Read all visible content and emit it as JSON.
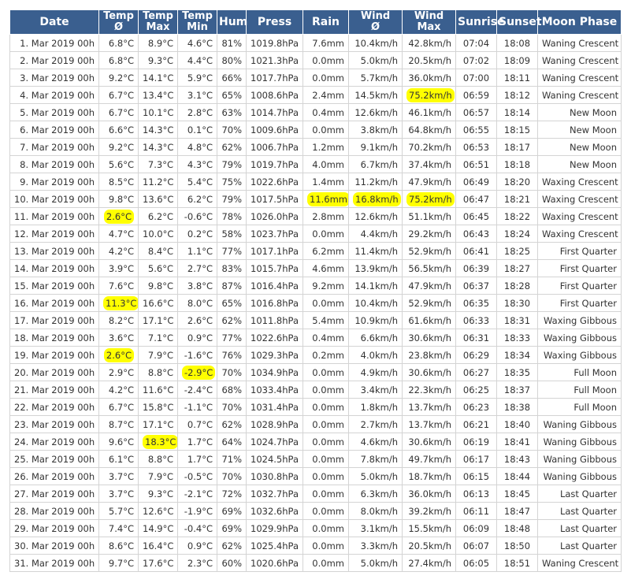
{
  "headers": [
    {
      "l1": "Date",
      "l2": ""
    },
    {
      "l1": "Temp",
      "l2": "Ø"
    },
    {
      "l1": "Temp",
      "l2": "Max"
    },
    {
      "l1": "Temp",
      "l2": "Min"
    },
    {
      "l1": "Hum",
      "l2": ""
    },
    {
      "l1": "Press",
      "l2": ""
    },
    {
      "l1": "Rain",
      "l2": ""
    },
    {
      "l1": "Wind",
      "l2": "Ø"
    },
    {
      "l1": "Wind",
      "l2": "Max"
    },
    {
      "l1": "Sunrise",
      "l2": ""
    },
    {
      "l1": "Sunset",
      "l2": ""
    },
    {
      "l1": "Moon Phase",
      "l2": ""
    }
  ],
  "highlight_color": "#ffff00",
  "header_color": "#3a5f8f",
  "rows": [
    [
      "1. Mar 2019 00h",
      "6.8°C",
      "8.9°C",
      "4.6°C",
      "81%",
      "1019.8hPa",
      "7.6mm",
      "10.4km/h",
      "42.8km/h",
      "07:04",
      "18:08",
      "Waning Crescent"
    ],
    [
      "2. Mar 2019 00h",
      "6.8°C",
      "9.3°C",
      "4.4°C",
      "80%",
      "1021.3hPa",
      "0.0mm",
      "5.0km/h",
      "20.5km/h",
      "07:02",
      "18:09",
      "Waning Crescent"
    ],
    [
      "3. Mar 2019 00h",
      "9.2°C",
      "14.1°C",
      "5.9°C",
      "66%",
      "1017.7hPa",
      "0.0mm",
      "5.7km/h",
      "36.0km/h",
      "07:00",
      "18:11",
      "Waning Crescent"
    ],
    [
      "4. Mar 2019 00h",
      "6.7°C",
      "13.4°C",
      "3.1°C",
      "65%",
      "1008.6hPa",
      "2.4mm",
      "14.5km/h",
      "75.2km/h",
      "06:59",
      "18:12",
      "Waning Crescent"
    ],
    [
      "5. Mar 2019 00h",
      "6.7°C",
      "10.1°C",
      "2.8°C",
      "63%",
      "1014.7hPa",
      "0.4mm",
      "12.6km/h",
      "46.1km/h",
      "06:57",
      "18:14",
      "New Moon"
    ],
    [
      "6. Mar 2019 00h",
      "6.6°C",
      "14.3°C",
      "0.1°C",
      "70%",
      "1009.6hPa",
      "0.0mm",
      "3.8km/h",
      "64.8km/h",
      "06:55",
      "18:15",
      "New Moon"
    ],
    [
      "7. Mar 2019 00h",
      "9.2°C",
      "14.3°C",
      "4.8°C",
      "62%",
      "1006.7hPa",
      "1.2mm",
      "9.1km/h",
      "70.2km/h",
      "06:53",
      "18:17",
      "New Moon"
    ],
    [
      "8. Mar 2019 00h",
      "5.6°C",
      "7.3°C",
      "4.3°C",
      "79%",
      "1019.7hPa",
      "4.0mm",
      "6.7km/h",
      "37.4km/h",
      "06:51",
      "18:18",
      "New Moon"
    ],
    [
      "9. Mar 2019 00h",
      "8.5°C",
      "11.2°C",
      "5.4°C",
      "75%",
      "1022.6hPa",
      "1.4mm",
      "11.2km/h",
      "47.9km/h",
      "06:49",
      "18:20",
      "Waxing Crescent"
    ],
    [
      "10. Mar 2019 00h",
      "9.8°C",
      "13.6°C",
      "6.2°C",
      "79%",
      "1017.5hPa",
      "11.6mm",
      "16.8km/h",
      "75.2km/h",
      "06:47",
      "18:21",
      "Waxing Crescent"
    ],
    [
      "11. Mar 2019 00h",
      "2.6°C",
      "6.2°C",
      "-0.6°C",
      "78%",
      "1026.0hPa",
      "2.8mm",
      "12.6km/h",
      "51.1km/h",
      "06:45",
      "18:22",
      "Waxing Crescent"
    ],
    [
      "12. Mar 2019 00h",
      "4.7°C",
      "10.0°C",
      "0.2°C",
      "58%",
      "1023.7hPa",
      "0.0mm",
      "4.4km/h",
      "29.2km/h",
      "06:43",
      "18:24",
      "Waxing Crescent"
    ],
    [
      "13. Mar 2019 00h",
      "4.2°C",
      "8.4°C",
      "1.1°C",
      "77%",
      "1017.1hPa",
      "6.2mm",
      "11.4km/h",
      "52.9km/h",
      "06:41",
      "18:25",
      "First Quarter"
    ],
    [
      "14. Mar 2019 00h",
      "3.9°C",
      "5.6°C",
      "2.7°C",
      "83%",
      "1015.7hPa",
      "4.6mm",
      "13.9km/h",
      "56.5km/h",
      "06:39",
      "18:27",
      "First Quarter"
    ],
    [
      "15. Mar 2019 00h",
      "7.6°C",
      "9.8°C",
      "3.8°C",
      "87%",
      "1016.4hPa",
      "9.2mm",
      "14.1km/h",
      "47.9km/h",
      "06:37",
      "18:28",
      "First Quarter"
    ],
    [
      "16. Mar 2019 00h",
      "11.3°C",
      "16.6°C",
      "8.0°C",
      "65%",
      "1016.8hPa",
      "0.0mm",
      "10.4km/h",
      "52.9km/h",
      "06:35",
      "18:30",
      "First Quarter"
    ],
    [
      "17. Mar 2019 00h",
      "8.2°C",
      "17.1°C",
      "2.6°C",
      "62%",
      "1011.8hPa",
      "5.4mm",
      "10.9km/h",
      "61.6km/h",
      "06:33",
      "18:31",
      "Waxing Gibbous"
    ],
    [
      "18. Mar 2019 00h",
      "3.6°C",
      "7.1°C",
      "0.9°C",
      "77%",
      "1022.6hPa",
      "0.4mm",
      "6.6km/h",
      "30.6km/h",
      "06:31",
      "18:33",
      "Waxing Gibbous"
    ],
    [
      "19. Mar 2019 00h",
      "2.6°C",
      "7.9°C",
      "-1.6°C",
      "76%",
      "1029.3hPa",
      "0.2mm",
      "4.0km/h",
      "23.8km/h",
      "06:29",
      "18:34",
      "Waxing Gibbous"
    ],
    [
      "20. Mar 2019 00h",
      "2.9°C",
      "8.8°C",
      "-2.9°C",
      "70%",
      "1034.9hPa",
      "0.0mm",
      "4.9km/h",
      "30.6km/h",
      "06:27",
      "18:35",
      "Full Moon"
    ],
    [
      "21. Mar 2019 00h",
      "4.2°C",
      "11.6°C",
      "-2.4°C",
      "68%",
      "1033.4hPa",
      "0.0mm",
      "3.4km/h",
      "22.3km/h",
      "06:25",
      "18:37",
      "Full Moon"
    ],
    [
      "22. Mar 2019 00h",
      "6.7°C",
      "15.8°C",
      "-1.1°C",
      "70%",
      "1031.4hPa",
      "0.0mm",
      "1.8km/h",
      "13.7km/h",
      "06:23",
      "18:38",
      "Full Moon"
    ],
    [
      "23. Mar 2019 00h",
      "8.7°C",
      "17.1°C",
      "0.7°C",
      "62%",
      "1028.9hPa",
      "0.0mm",
      "2.7km/h",
      "13.7km/h",
      "06:21",
      "18:40",
      "Waning Gibbous"
    ],
    [
      "24. Mar 2019 00h",
      "9.6°C",
      "18.3°C",
      "1.7°C",
      "64%",
      "1024.7hPa",
      "0.0mm",
      "4.6km/h",
      "30.6km/h",
      "06:19",
      "18:41",
      "Waning Gibbous"
    ],
    [
      "25. Mar 2019 00h",
      "6.1°C",
      "8.8°C",
      "1.7°C",
      "71%",
      "1024.5hPa",
      "0.0mm",
      "7.8km/h",
      "49.7km/h",
      "06:17",
      "18:43",
      "Waning Gibbous"
    ],
    [
      "26. Mar 2019 00h",
      "3.7°C",
      "7.9°C",
      "-0.5°C",
      "70%",
      "1030.8hPa",
      "0.0mm",
      "5.0km/h",
      "18.7km/h",
      "06:15",
      "18:44",
      "Waning Gibbous"
    ],
    [
      "27. Mar 2019 00h",
      "3.7°C",
      "9.3°C",
      "-2.1°C",
      "72%",
      "1032.7hPa",
      "0.0mm",
      "6.3km/h",
      "36.0km/h",
      "06:13",
      "18:45",
      "Last Quarter"
    ],
    [
      "28. Mar 2019 00h",
      "5.7°C",
      "12.6°C",
      "-1.9°C",
      "69%",
      "1032.6hPa",
      "0.0mm",
      "8.0km/h",
      "39.2km/h",
      "06:11",
      "18:47",
      "Last Quarter"
    ],
    [
      "29. Mar 2019 00h",
      "7.4°C",
      "14.9°C",
      "-0.4°C",
      "69%",
      "1029.9hPa",
      "0.0mm",
      "3.1km/h",
      "15.5km/h",
      "06:09",
      "18:48",
      "Last Quarter"
    ],
    [
      "30. Mar 2019 00h",
      "8.6°C",
      "16.4°C",
      "0.9°C",
      "62%",
      "1025.4hPa",
      "0.0mm",
      "3.3km/h",
      "20.5km/h",
      "06:07",
      "18:50",
      "Last Quarter"
    ],
    [
      "31. Mar 2019 00h",
      "9.7°C",
      "17.6°C",
      "2.3°C",
      "60%",
      "1020.6hPa",
      "0.0mm",
      "5.0km/h",
      "27.4km/h",
      "06:05",
      "18:51",
      "Waning Crescent"
    ]
  ],
  "highlights": [
    {
      "row": 3,
      "col": 8
    },
    {
      "row": 9,
      "col": 6
    },
    {
      "row": 9,
      "col": 7
    },
    {
      "row": 9,
      "col": 8
    },
    {
      "row": 10,
      "col": 1
    },
    {
      "row": 15,
      "col": 1
    },
    {
      "row": 18,
      "col": 1
    },
    {
      "row": 19,
      "col": 3
    },
    {
      "row": 23,
      "col": 2
    }
  ]
}
